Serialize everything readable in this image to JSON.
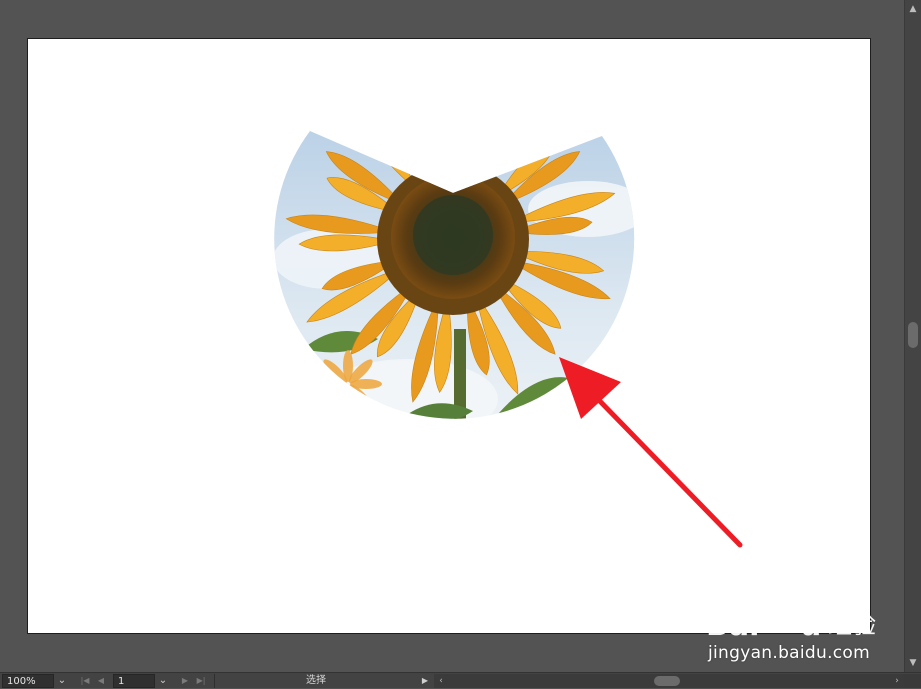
{
  "canvas": {
    "artboard_color": "#ffffff",
    "workspace_color": "#535353",
    "artwork": {
      "subject": "sunflower",
      "sky_color": "#cfe0ee",
      "petal_color": "#f3ae2a",
      "center_color": "#5a3b12",
      "leaf_color": "#5f8a3a"
    },
    "annotation": {
      "arrow_color": "#ee1c24"
    }
  },
  "statusbar": {
    "zoom_value": "100%",
    "page_value": "1",
    "tool_status": "选择"
  },
  "watermark": {
    "brand": "Baidu 经验",
    "url": "jingyan.baidu.com"
  }
}
